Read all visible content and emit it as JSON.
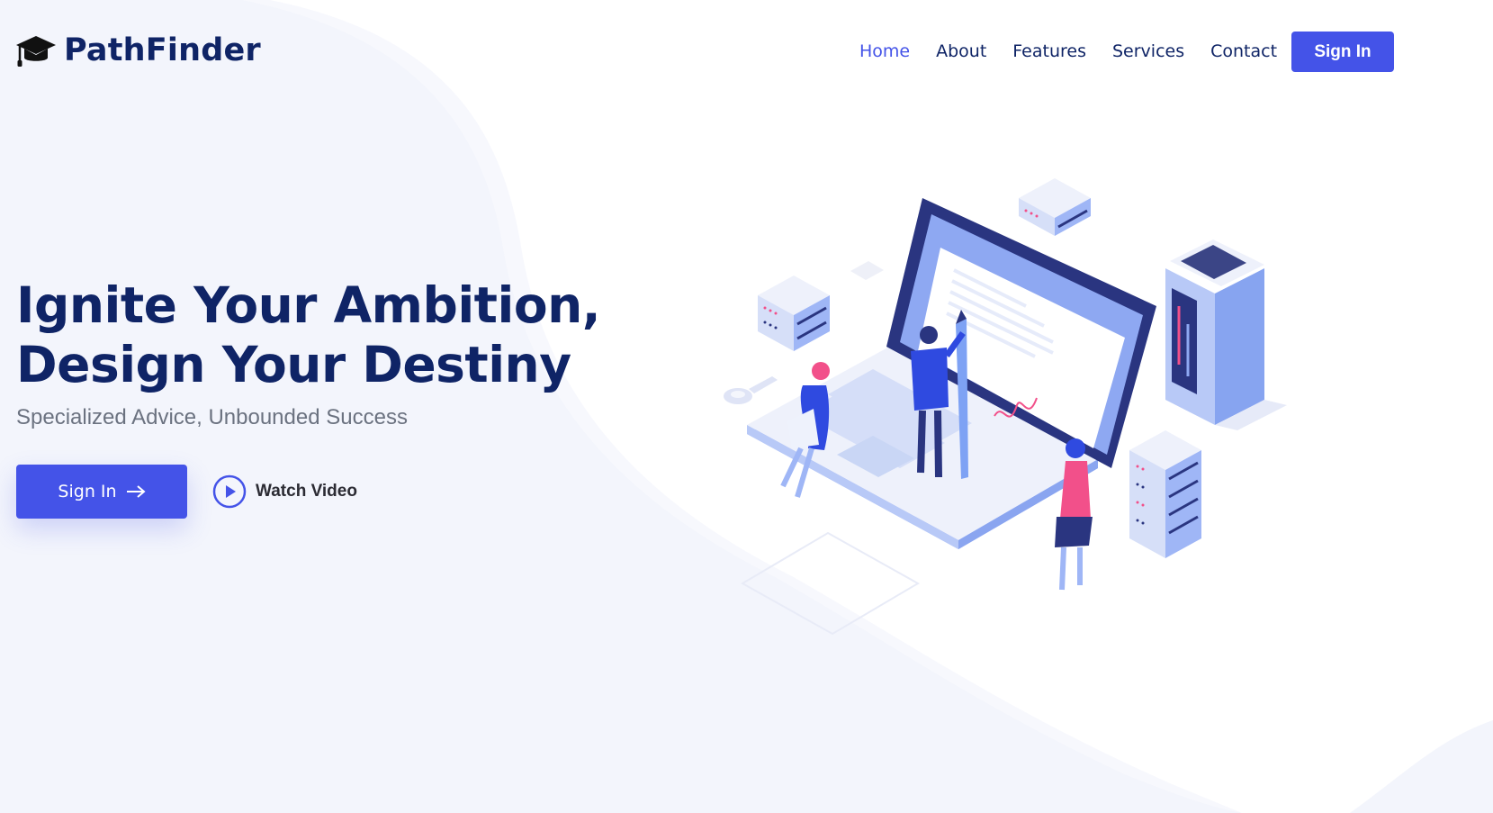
{
  "brand": {
    "name": "PathFinder",
    "icon": "graduation-cap-icon"
  },
  "nav": {
    "items": [
      {
        "label": "Home",
        "active": true
      },
      {
        "label": "About",
        "active": false
      },
      {
        "label": "Features",
        "active": false
      },
      {
        "label": "Services",
        "active": false
      },
      {
        "label": "Contact",
        "active": false
      }
    ],
    "signin_label": "Sign In"
  },
  "hero": {
    "title_line1": "Ignite Your Ambition,",
    "title_line2": "Design Your Destiny",
    "subtitle": "Specialized Advice, Unbounded Success",
    "cta_label": "Sign In",
    "cta_icon": "arrow-right-icon",
    "video_label": "Watch Video",
    "video_icon": "play-circle-icon"
  },
  "colors": {
    "accent": "#4453e8",
    "navy": "#0f2466",
    "muted_text": "#6b7280",
    "bg_tint": "#f2f4fc",
    "pink": "#f2508a"
  }
}
